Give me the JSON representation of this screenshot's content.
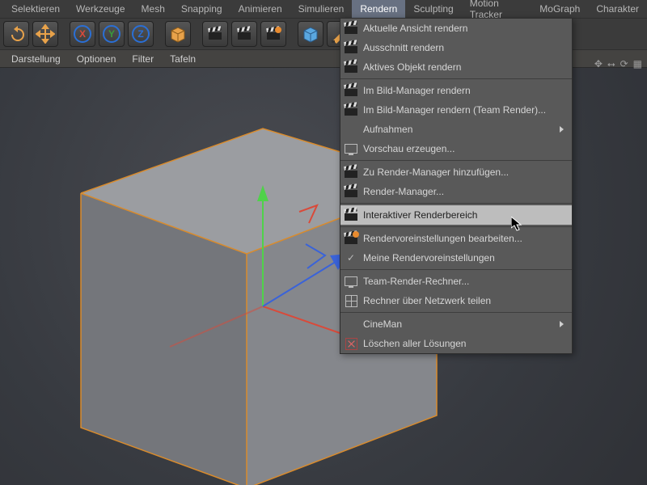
{
  "menubar": {
    "items": [
      {
        "label": "Selektieren"
      },
      {
        "label": "Werkzeuge"
      },
      {
        "label": "Mesh"
      },
      {
        "label": "Snapping"
      },
      {
        "label": "Animieren"
      },
      {
        "label": "Simulieren"
      },
      {
        "label": "Rendern",
        "active": true
      },
      {
        "label": "Sculpting"
      },
      {
        "label": "Motion Tracker"
      },
      {
        "label": "MoGraph"
      },
      {
        "label": "Charakter"
      }
    ]
  },
  "tabs": {
    "items": [
      {
        "label": "Darstellung"
      },
      {
        "label": "Optionen"
      },
      {
        "label": "Filter"
      },
      {
        "label": "Tafeln"
      }
    ]
  },
  "dropdown": {
    "groups": [
      [
        {
          "icon": "clapper",
          "label": "Aktuelle Ansicht rendern"
        },
        {
          "icon": "clapper",
          "label": "Ausschnitt rendern"
        },
        {
          "icon": "clapper",
          "label": "Aktives Objekt rendern"
        }
      ],
      [
        {
          "icon": "clapper",
          "label": "Im Bild-Manager rendern"
        },
        {
          "icon": "clapper",
          "label": "Im Bild-Manager rendern (Team Render)..."
        },
        {
          "icon": "none",
          "label": "Aufnahmen",
          "submenu": true
        },
        {
          "icon": "monitor",
          "label": "Vorschau erzeugen..."
        }
      ],
      [
        {
          "icon": "clapper",
          "label": "Zu Render-Manager hinzufügen..."
        },
        {
          "icon": "clapper",
          "label": "Render-Manager..."
        }
      ],
      [
        {
          "icon": "clapper",
          "label": "Interaktiver Renderbereich",
          "highlight": true
        }
      ],
      [
        {
          "icon": "clapper-gear",
          "label": "Rendervoreinstellungen bearbeiten..."
        },
        {
          "icon": "check",
          "label": "Meine Rendervoreinstellungen"
        }
      ],
      [
        {
          "icon": "monitor",
          "label": "Team-Render-Rechner..."
        },
        {
          "icon": "net",
          "label": "Rechner über Netzwerk teilen"
        }
      ],
      [
        {
          "icon": "none",
          "label": "CineMan",
          "submenu": true
        },
        {
          "icon": "x",
          "label": "Löschen aller Lösungen"
        }
      ]
    ]
  },
  "colors": {
    "cube_edge": "#d98b2c",
    "axis_x": "#d94a3a",
    "axis_y": "#4fd24a",
    "axis_z": "#3a63d9"
  }
}
